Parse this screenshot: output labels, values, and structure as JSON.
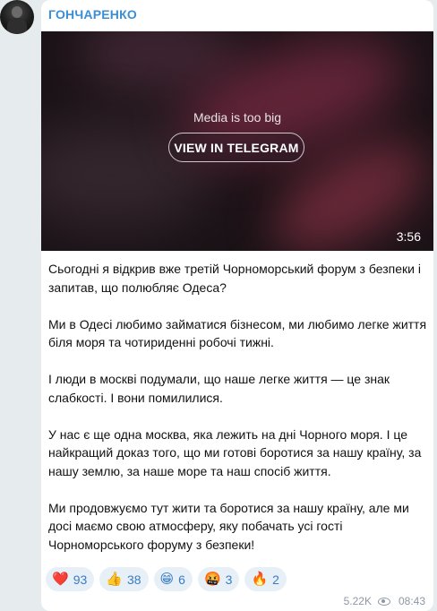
{
  "post": {
    "channel_name": "ГОНЧАРЕНКО",
    "media": {
      "message": "Media is too big",
      "button_label": "VIEW IN TELEGRAM",
      "duration": "3:56"
    },
    "paragraphs": [
      "Сьогодні я відкрив вже третій Чорноморський форум з безпеки і запитав, що полюбляє Одеса?",
      "Ми в Одесі любимо займатися бізнесом, ми любимо легке життя біля моря та чотириденні робочі тижні.",
      "І люди в москві подумали, що наше легке життя — це знак слабкості. І вони помилилися.",
      "У нас є ще одна москва, яка лежить на дні Чорного моря. І це найкращий доказ того, що ми готові боротися за нашу країну, за нашу землю, за наше море та наш спосіб життя.",
      "Ми продовжуємо тут жити та боротися за нашу країну, але ми досі маємо свою атмосферу, яку побачать усі гості Чорноморського форуму з безпеки!"
    ],
    "reactions": [
      {
        "emoji": "❤️",
        "count": "93",
        "icon": "heart-icon"
      },
      {
        "emoji": "👍",
        "count": "38",
        "icon": "thumbs-up-icon"
      },
      {
        "emoji": "😁",
        "count": "6",
        "icon": "grin-icon"
      },
      {
        "emoji": "🤬",
        "count": "3",
        "icon": "angry-face-icon"
      },
      {
        "emoji": "🔥",
        "count": "2",
        "icon": "fire-icon"
      }
    ],
    "views": "5.22K",
    "time": "08:43"
  },
  "colors": {
    "channel_name": "#3a8ed6",
    "reaction_bg": "#e8f0f7",
    "reaction_text": "#3a7cc2",
    "meta_text": "#8b98a4"
  }
}
